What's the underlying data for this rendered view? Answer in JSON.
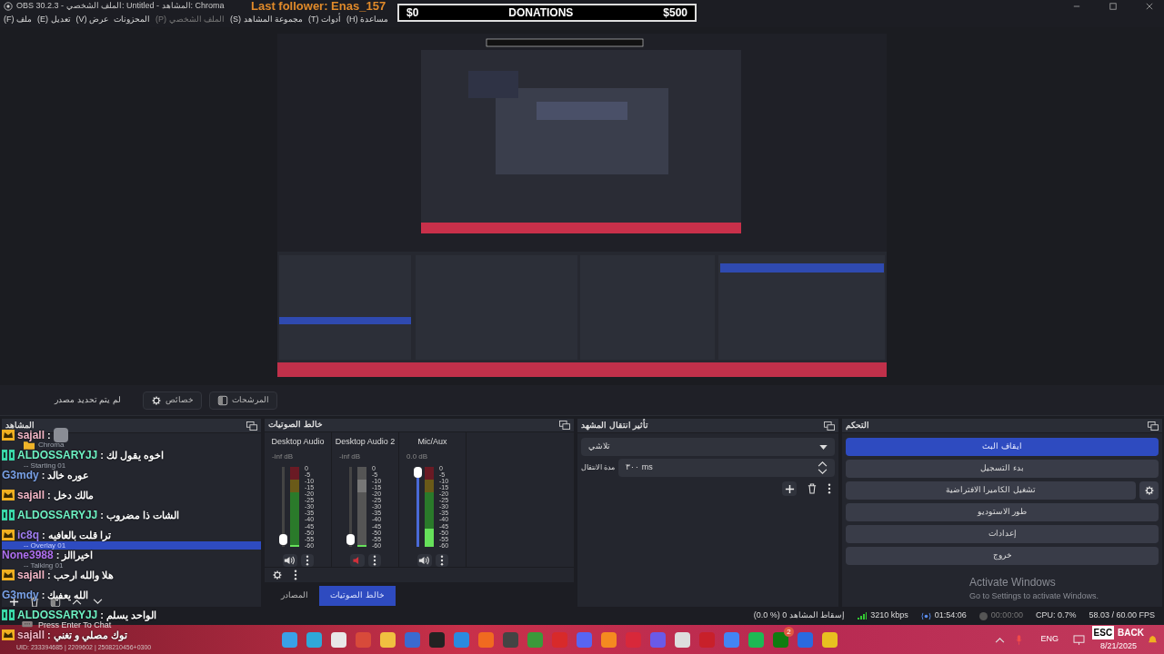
{
  "window": {
    "title": "OBS 30.2.3 - الملف الشخصي: Untitled - المشاهد: Chroma"
  },
  "stream_overlay": {
    "follower": "Last follower: Enas_157",
    "donations": {
      "min": "$0",
      "label": "DONATIONS",
      "max": "$500"
    }
  },
  "menu": [
    {
      "label": "(H) مساعدة",
      "disabled": false
    },
    {
      "label": "(T) أدوات",
      "disabled": false
    },
    {
      "label": "(S) مجموعة المشاهد",
      "disabled": false
    },
    {
      "label": "(P) الملف الشخصي",
      "disabled": true
    },
    {
      "label": "المحزونات",
      "disabled": false
    },
    {
      "label": "(V) عرض",
      "disabled": false
    },
    {
      "label": "(E) تعديل",
      "disabled": false
    },
    {
      "label": "(F) ملف",
      "disabled": false
    }
  ],
  "source_toolbar": {
    "status": "لم يتم تحديد مصدر",
    "buttons": [
      {
        "label": "المرشحات",
        "kind": "filters"
      },
      {
        "label": "خصائص",
        "kind": "properties"
      }
    ]
  },
  "scenes": {
    "title": "المشاهد",
    "items": [
      {
        "label": "Chroma",
        "kind": "folder",
        "selected": false
      },
      {
        "label": "-- Starting 01",
        "kind": "scene",
        "selected": false
      },
      {
        "label": "-- Overlay 01",
        "kind": "scene",
        "selected": true
      },
      {
        "label": "-- Talking 01",
        "kind": "scene",
        "selected": false
      }
    ]
  },
  "mixer": {
    "title": "خالط الصوتيات",
    "channels": [
      {
        "name": "Mic/Aux",
        "reading": "0.0 dB",
        "muted": false,
        "fader": {
          "level": 1
        },
        "meter": {
          "level": 0.22
        },
        "scale": [
          "0",
          "-5",
          "-10",
          "-15",
          "-20",
          "-25",
          "-30",
          "-35",
          "-40",
          "-45",
          "-50",
          "-55",
          "-60"
        ]
      },
      {
        "name": "Desktop Audio 2",
        "reading": "-inf dB",
        "muted": true,
        "fader": {
          "level": 0.02
        },
        "meter": {
          "level": 0
        },
        "scale": [
          "0",
          "-5",
          "-10",
          "-15",
          "-20",
          "-25",
          "-30",
          "-35",
          "-40",
          "-45",
          "-50",
          "-55",
          "-60"
        ]
      },
      {
        "name": "Desktop Audio",
        "reading": "-inf dB",
        "muted": false,
        "fader": {
          "level": 0.02
        },
        "meter": {
          "level": 0
        },
        "scale": [
          "0",
          "-5",
          "-10",
          "-15",
          "-20",
          "-25",
          "-30",
          "-35",
          "-40",
          "-45",
          "-50",
          "-55",
          "-60"
        ]
      }
    ]
  },
  "dock_tabs": [
    {
      "label": "خالط الصوتيات",
      "selected": true
    },
    {
      "label": "المصادر",
      "selected": false
    }
  ],
  "transitions": {
    "title": "تأثير انتقال المشهد",
    "type": "تلاشي",
    "duration_label": "مدة الانتقال",
    "duration": "٣٠٠ ms"
  },
  "controls": {
    "title": "التحكم",
    "buttons": [
      {
        "label": "ايقاف البث",
        "active": true,
        "has_settings": false
      },
      {
        "label": "بدء التسجيل",
        "active": false,
        "has_settings": false
      },
      {
        "label": "تشغيل الكاميرا الافتراضية",
        "active": false,
        "has_settings": true
      },
      {
        "label": "طور الاستوديو",
        "active": false,
        "has_settings": false
      },
      {
        "label": "إعدادات",
        "active": false,
        "has_settings": false
      },
      {
        "label": "خروج",
        "active": false,
        "has_settings": false
      }
    ],
    "activation": {
      "title": "Activate Windows",
      "subtitle": "Go to Settings to activate Windows."
    }
  },
  "status_bar": {
    "dropped": "(0.0 %) 0 إسقاط المشاهد",
    "bitrate": "3210 kbps",
    "stream_time": "01:54:06",
    "record_time": "00:00:00",
    "cpu": "CPU: 0.7%",
    "fps": "58.03 / 60.00 FPS"
  },
  "chat": {
    "messages": [
      {
        "user": "sajall",
        "kind": "crown",
        "color": "#f2b6c6",
        "text": ":",
        "emote": true
      },
      {
        "user": "ALDOSSARYJJ",
        "kind": "bits",
        "color": "#6ef2c4",
        "text": ": اخوه يقول لك",
        "emote": false
      },
      {
        "user": "G3mdy",
        "kind": "plain",
        "color": "#7aa2e8",
        "text": ": عوره خالد",
        "emote": false
      },
      {
        "user": "sajall",
        "kind": "crown",
        "color": "#f2b6c6",
        "text": ": مالك دخل",
        "emote": false
      },
      {
        "user": "ALDOSSARYJJ",
        "kind": "bits",
        "color": "#6ef2c4",
        "text": ": الشات ذا مضروب",
        "emote": false
      },
      {
        "user": "ic8q",
        "kind": "crown",
        "color": "#a07ef2",
        "text": ": ترا قلت بالعافيه",
        "emote": false
      },
      {
        "user": "None3988",
        "kind": "plain",
        "color": "#b070f0",
        "text": ": اخيراالز",
        "emote": false
      },
      {
        "user": "sajall",
        "kind": "crown",
        "color": "#f2b6c6",
        "text": ": هلا والله ارحب",
        "emote": false
      },
      {
        "user": "G3mdy",
        "kind": "plain",
        "color": "#7aa2e8",
        "text": ": الله يعفيك",
        "emote": false
      },
      {
        "user": "ALDOSSARYJJ",
        "kind": "bits",
        "color": "#6ef2c4",
        "text": ": الواحد يسلم",
        "emote": false
      },
      {
        "user": "sajall",
        "kind": "crown",
        "color": "#f2b6c6",
        "text": ": توك مصلي و تغني",
        "emote": false
      }
    ],
    "hint": "Press Enter To Chat",
    "uid": "UID: 233394685 | 2209602 | 2508210456+0300"
  },
  "taskbar": {
    "badge": "2",
    "language": "ENG",
    "date": "8/21/2025",
    "overlay_keys": [
      "BACK",
      "ESC"
    ]
  }
}
